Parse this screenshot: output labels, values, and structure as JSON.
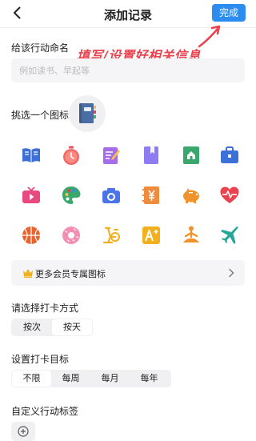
{
  "header": {
    "title": "添加记录",
    "done_label": "完成"
  },
  "annotation": "填写/设置好相关信息",
  "name_section": {
    "label": "给该行动命名",
    "placeholder": "例如读书、早起等",
    "value": ""
  },
  "icon_section": {
    "label": "挑选一个图标",
    "selected_icon": "notebook-icon",
    "icons": [
      "book-icon",
      "stopwatch-icon",
      "pencil-note-icon",
      "bookmark-icon",
      "home-book-icon",
      "briefcase-icon",
      "tv-icon",
      "palette-icon",
      "camera-icon",
      "yen-ledger-icon",
      "piggy-bank-icon",
      "heartbeat-icon",
      "basketball-icon",
      "donut-icon",
      "exercise-bike-icon",
      "grade-a-plus-icon",
      "meditation-icon",
      "airplane-icon"
    ]
  },
  "vip_row": {
    "label": "更多会员专属图标"
  },
  "checkin_mode": {
    "label": "请选择打卡方式",
    "options": [
      "按次",
      "按天"
    ],
    "selected": "按天"
  },
  "checkin_goal": {
    "label": "设置打卡目标",
    "options": [
      "不限",
      "每周",
      "每月",
      "每年"
    ],
    "selected": "不限"
  },
  "tags_section": {
    "label": "自定义行动标签"
  },
  "colors": {
    "accent": "#2d8cf0",
    "annotation": "#e8434f",
    "field_bg": "#f5f5f7"
  }
}
